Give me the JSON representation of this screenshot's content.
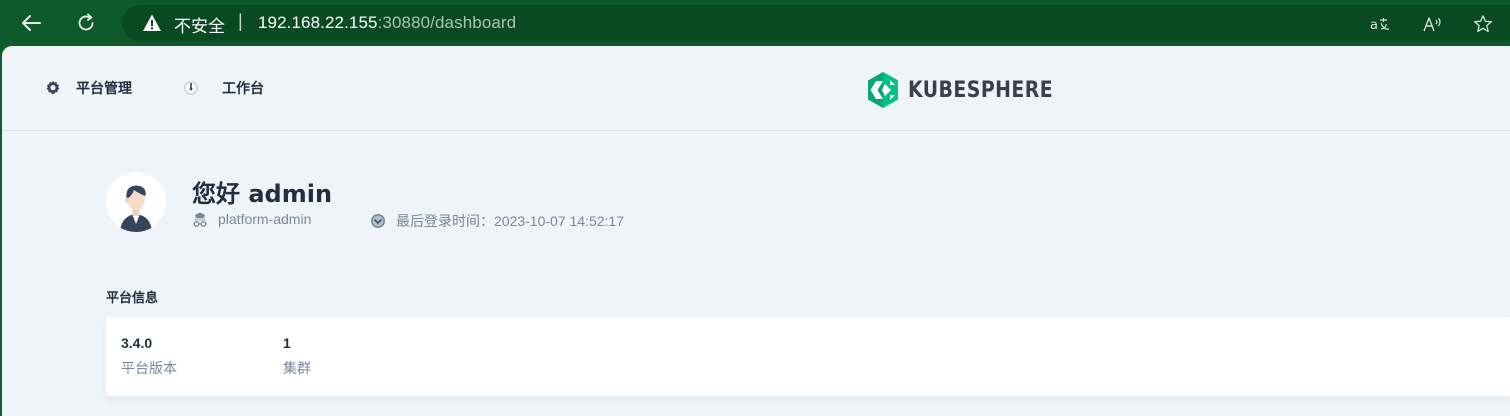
{
  "browser": {
    "insecure_label": "不安全",
    "separator": "|",
    "url_host": "192.168.22.155",
    "url_rest": ":30880/dashboard"
  },
  "nav": {
    "platform_label": "平台管理",
    "workbench_label": "工作台"
  },
  "logo": {
    "text": "KUBESPHERE",
    "color": "#00aa72"
  },
  "user": {
    "greeting": "您好 admin",
    "role": "platform-admin",
    "last_login": "最后登录时间：2023-10-07 14:52:17"
  },
  "platform_info": {
    "title": "平台信息",
    "stats": [
      {
        "value": "3.4.0",
        "label": "平台版本"
      },
      {
        "value": "1",
        "label": "集群"
      }
    ]
  },
  "colors": {
    "browser_bar": "#0f5a2b",
    "page_bg": "#eff4f8",
    "text_primary": "#242e42",
    "text_secondary": "#79879c"
  }
}
